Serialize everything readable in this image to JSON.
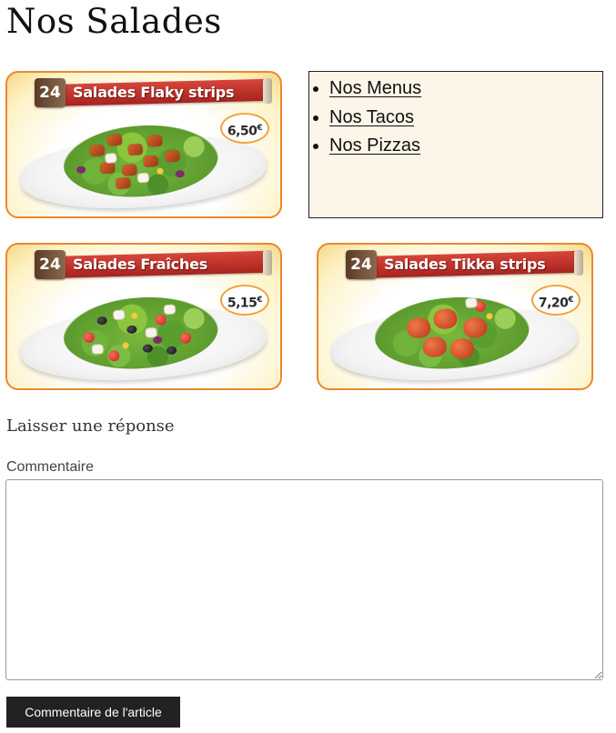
{
  "page": {
    "title": "Nos Salades"
  },
  "products": [
    {
      "number": "24",
      "name": "Salades Flaky strips",
      "price": "6,50",
      "currency": "€",
      "image_icon": "salad-flaky-strips-image"
    },
    {
      "number": "24",
      "name": "Salades Fraîches",
      "price": "5,15",
      "currency": "€",
      "image_icon": "salad-fraiches-image"
    },
    {
      "number": "24",
      "name": "Salades Tikka strips",
      "price": "7,20",
      "currency": "€",
      "image_icon": "salad-tikka-strips-image"
    }
  ],
  "nav": {
    "items": [
      {
        "label": "Nos Menus"
      },
      {
        "label": "Nos Tacos"
      },
      {
        "label": "Nos Pizzas"
      }
    ]
  },
  "comments": {
    "reply_title": "Laisser une réponse",
    "comment_label": "Commentaire",
    "comment_value": "",
    "submit_label": "Commentaire de l'article"
  },
  "colors": {
    "card_border": "#e8892f",
    "banner_red": "#b8281f",
    "nav_background": "#fcf5e8",
    "button_background": "#222222"
  }
}
